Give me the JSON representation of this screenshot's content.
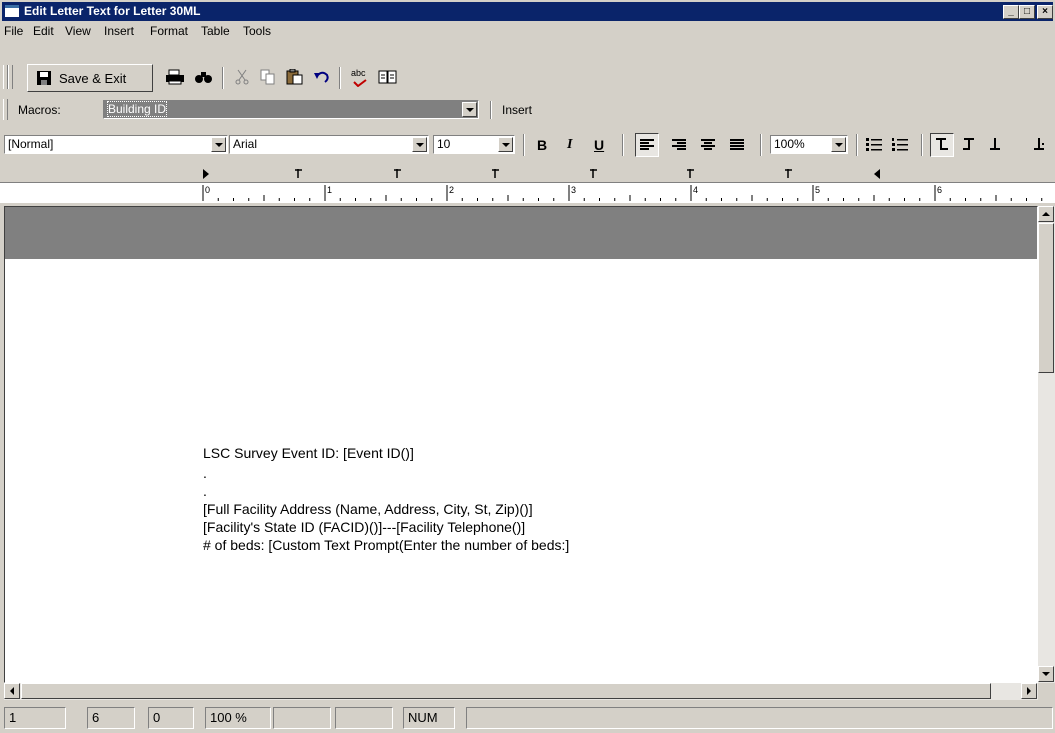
{
  "window": {
    "title": "Edit Letter Text for Letter 30ML"
  },
  "menu": [
    "File",
    "Edit",
    "View",
    "Insert",
    "Format",
    "Table",
    "Tools"
  ],
  "toolbar": {
    "save_exit": "Save & Exit",
    "spell_label": "abc"
  },
  "macros": {
    "label": "Macros:",
    "value": "Building ID",
    "insert": "Insert"
  },
  "format": {
    "style": "[Normal]",
    "font": "Arial",
    "size": "10",
    "bold": "B",
    "italic": "I",
    "underline": "U",
    "zoom": "100%"
  },
  "ruler": [
    "0",
    "1",
    "2",
    "3",
    "4",
    "5",
    "6"
  ],
  "document": {
    "lines": [
      "LSC Survey Event ID:   [Event ID()]",
      ".",
      ".",
      "[Full Facility Address (Name, Address, City, St, Zip)()]",
      "[Facility's State ID (FACID)()]---[Facility Telephone()]",
      "# of beds: [Custom Text Prompt(Enter the number of beds:]"
    ]
  },
  "status": [
    "1",
    "6",
    "0",
    "100 %",
    "",
    "",
    "NUM",
    ""
  ],
  "icons": [
    "save-icon",
    "print-icon",
    "find-icon",
    "cut-icon",
    "copy-icon",
    "paste-icon",
    "undo-icon",
    "spellcheck-icon",
    "thesaurus-icon"
  ]
}
